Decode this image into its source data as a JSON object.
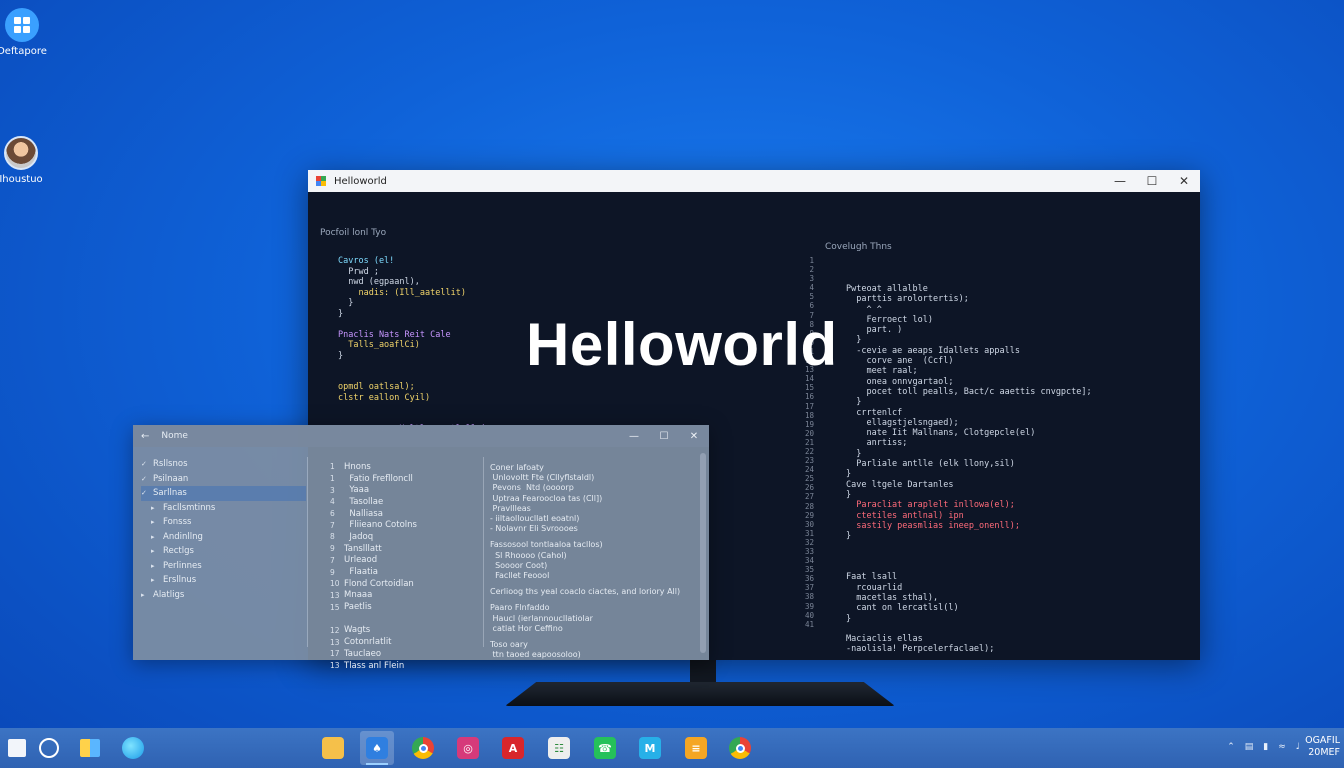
{
  "desktop": {
    "icons": [
      {
        "label": "Deftapore",
        "icon": "apps-grid-icon"
      },
      {
        "label": "Ihoustuo",
        "icon": "user-avatar-icon"
      }
    ]
  },
  "main_window": {
    "title": "Helloworld",
    "overlay_text": "Helloworld",
    "left_pane_title": "Pocfoil lonl Tyo",
    "right_pane_title": "Covelugh Thns",
    "left_code": [
      "Cavros (el!",
      "  Prwd ;",
      "  nwd (egpaanl),",
      "    nadis: (Ill_aatellit)",
      "  }",
      "}",
      "",
      "Pnaclis Nats Reit Cale",
      "  Talls_aoaflCi)",
      "}",
      "",
      "",
      "opmdl oatlsal);",
      "clstr eallon Cyil)",
      "",
      "",
      "youwr waas: Haltlng_oatlclle)",
      "{"
    ],
    "right_code": [
      "Pwteoat allalble",
      "  parttis arolortertis);",
      "    ^ ^",
      "    Ferroect lol)",
      "    part. )",
      "  }",
      "  -cevie ae aeaps Idallets appalls",
      "    corve ane  (Ccfl)",
      "    meet raal;",
      "    onea onnvgartaol;",
      "    pocet toll pealls, Bact/c aaettis cnvgpcte];",
      "  }",
      "  crrtenlcf",
      "    ellagstjelsngaed);",
      "    nate Iit Mallnans, Clotgepcle(el)",
      "    anrtiss;",
      "  }",
      "  Parliale antlle (elk llony,sil)",
      "}",
      "Cave ltgele Dartanles",
      "}",
      "  Paracliat araplelt inllowa(el);",
      "  ctetiles antlnal) ipn",
      "  sastily peasmlias ineep_onenll);",
      "}",
      "",
      "",
      "",
      "Faat lsall",
      "  rcouarlid",
      "  macetlas sthal),",
      "  cant on lercatlsl(l)",
      "}",
      "",
      "Maciaclis ellas",
      "-naolisla! Perpcelerfaclael);"
    ]
  },
  "file_window": {
    "title": "Nome",
    "nav": [
      {
        "label": "Rsllsnos",
        "level": 0,
        "selected": false
      },
      {
        "label": "Psilnaan",
        "level": 0,
        "selected": false
      },
      {
        "label": "Sarllnas",
        "level": 0,
        "selected": true
      },
      {
        "label": "Facllsmtinns",
        "level": 1,
        "selected": false
      },
      {
        "label": "Fonsss",
        "level": 1,
        "selected": false
      },
      {
        "label": "Andinllng",
        "level": 1,
        "selected": false
      },
      {
        "label": "Rectlgs",
        "level": 1,
        "selected": false
      },
      {
        "label": "Perlinnes",
        "level": 1,
        "selected": false
      },
      {
        "label": "Ersllnus",
        "level": 1,
        "selected": false
      },
      {
        "label": "Alatligs",
        "level": 0,
        "selected": false
      }
    ],
    "middle": [
      {
        "n": "1",
        "t": "Hnons"
      },
      {
        "n": "1",
        "t": "  Fatio Freflloncll"
      },
      {
        "n": "3",
        "t": "  Yaaa"
      },
      {
        "n": "4",
        "t": "  Tasollae"
      },
      {
        "n": "6",
        "t": "  Nalliasa"
      },
      {
        "n": "7",
        "t": "  Fliieano Cotolns"
      },
      {
        "n": "8",
        "t": "  Jadoq"
      },
      {
        "n": "9",
        "t": "Tanslllatt"
      },
      {
        "n": "7",
        "t": "Urleaod"
      },
      {
        "n": "9",
        "t": "  Flaatia"
      },
      {
        "n": "10",
        "t": "Flond Cortoidlan"
      },
      {
        "n": "13",
        "t": "Mnaaa"
      },
      {
        "n": "15",
        "t": "Paetlis"
      },
      {
        "n": "",
        "t": ""
      },
      {
        "n": "12",
        "t": "Wagts"
      },
      {
        "n": "13",
        "t": "Cotonrlatlit"
      },
      {
        "n": "17",
        "t": "Tauclaeo"
      },
      {
        "n": "13",
        "t": "Tlass anl Flein"
      }
    ],
    "right": [
      "Coner lafoaty\n Unlovoltt Fte (Cllyflstaldl)\n Pevons  Ntd (oooorp\n Uptraa Fearoocloa tas (Cll])\n Pravllleas\n- iiltaolloucllatl eoatnl)\n- Nolavnr Eli Svroooes",
      "Fassosool tontlaaloa tacllos)\n  Sl Rhoooo (Cahol)\n  Soooor Coot)\n  Facllet Feoool",
      "Cerlioog ths yeal coaclo ciactes, and loriory All)",
      "Paaro Flnfaddo\n Haucl (ierlannoucllatiolar\n catlat Hor Ceffino",
      "Toso oary\n ttn taoed eapoosoloo)"
    ]
  },
  "taskbar": {
    "apps": [
      {
        "name": "file-explorer",
        "icon": "folder-icon",
        "color": "#f5c04a",
        "glyph": ""
      },
      {
        "name": "store",
        "icon": "store-icon",
        "color": "#2f7fe0",
        "glyph": "♠"
      },
      {
        "name": "chrome",
        "icon": "chrome-icon",
        "color": "#e9a030",
        "glyph": ""
      },
      {
        "name": "instagram",
        "icon": "instagram-icon",
        "color": "#d63a7a",
        "glyph": "◎"
      },
      {
        "name": "acrobat",
        "icon": "acrobat-icon",
        "color": "#d8262b",
        "glyph": "A"
      },
      {
        "name": "sheets",
        "icon": "spreadsheet-icon",
        "color": "#eeeeee",
        "glyph": "☷"
      },
      {
        "name": "whatsapp",
        "icon": "whatsapp-icon",
        "color": "#25c15a",
        "glyph": "☎"
      },
      {
        "name": "mail",
        "icon": "mail-icon",
        "color": "#27b0e8",
        "glyph": "M"
      },
      {
        "name": "books",
        "icon": "book-icon",
        "color": "#f5a623",
        "glyph": "≡"
      },
      {
        "name": "chrome-2",
        "icon": "chrome-icon",
        "color": "#e94a35",
        "glyph": ""
      }
    ],
    "clock_top": "OGAFIL",
    "clock_bottom": "20MEF"
  }
}
